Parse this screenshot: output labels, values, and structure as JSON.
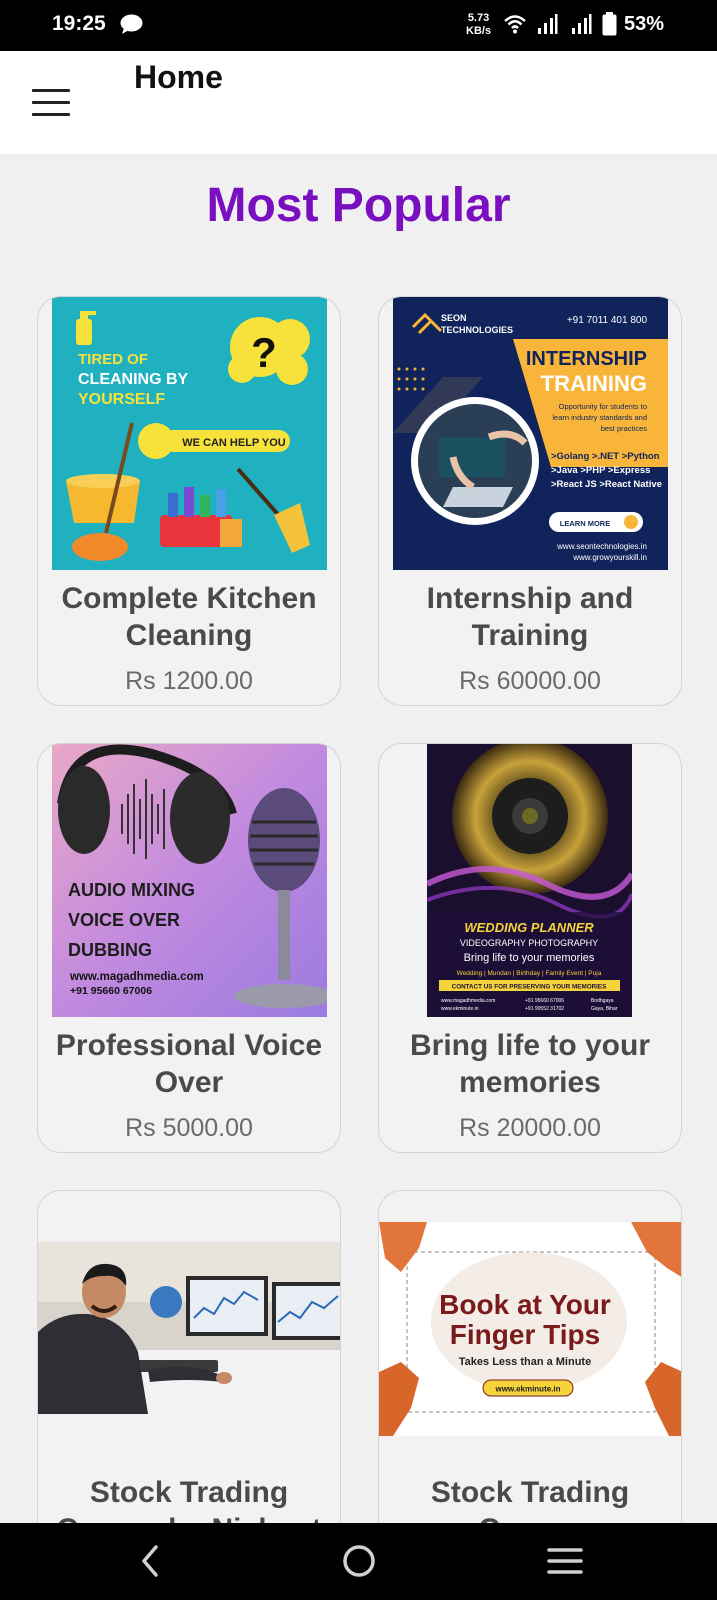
{
  "status_bar": {
    "time": "19:25",
    "speed_value": "5.73",
    "speed_unit": "KB/s",
    "battery": "53%"
  },
  "app_bar": {
    "title": "Home"
  },
  "section": {
    "title": "Most Popular"
  },
  "products": [
    {
      "name": "Complete Kitchen Cleaning",
      "price": "Rs 1200.00",
      "image": {
        "line1": "TIRED OF",
        "line2": "CLEANING BY",
        "line3": "YOURSELF",
        "tagline": "WE CAN HELP YOU"
      }
    },
    {
      "name": "Internship and Training",
      "price": "Rs 60000.00",
      "image": {
        "brand": "SEON",
        "brand2": "TECHNOLOGIES",
        "phone": "+91 7011 401 800",
        "headline1": "INTERNSHIP",
        "headline2": "TRAINING",
        "desc1": "Opportunity for students to",
        "desc2": "learn industry standards and",
        "desc3": "best practices",
        "tech1": ">Golang >.NET >Python",
        "tech2": ">Java >PHP >Express",
        "tech3": ">React JS >React Native",
        "cta": "LEARN MORE",
        "web1": "www.seontechnologies.in",
        "web2": "www.growyourskill.in"
      }
    },
    {
      "name": "Professional Voice Over",
      "price": "Rs 5000.00",
      "image": {
        "line1": "AUDIO MIXING",
        "line2": "VOICE OVER",
        "line3": "DUBBING",
        "web": "www.magadhmedia.com",
        "phone": "+91 95660 67006"
      }
    },
    {
      "name": "Bring life to your memories",
      "price": "Rs 20000.00",
      "image": {
        "headline": "WEDDING PLANNER",
        "sub": "VIDEOGRAPHY  PHOTOGRAPHY",
        "tagline": "Bring life to your memories",
        "events": "Wedding | Mundan | Birthday | Family Event | Puja",
        "cta": "CONTACT US FOR PRESERVING YOUR MEMORIES",
        "web1": "www.magadhmedia.com",
        "web2": "www.ekminute.in",
        "phone1": "+91 95660 67006",
        "phone2": "+91 90552 31702",
        "place1": "Bodhgaya",
        "place2": "Gaya, Bihar"
      }
    },
    {
      "name": "Stock Trading Course by Nishant",
      "price": "",
      "image": {}
    },
    {
      "name": "Stock Trading Course",
      "price": "",
      "image": {
        "headline1": "Book at Your",
        "headline2": "Finger Tips",
        "sub": "Takes Less than a Minute",
        "web": "www.ekminute.in"
      }
    }
  ],
  "colors": {
    "accent": "#7a0fc0",
    "background": "#f0f0f0"
  },
  "icons": {
    "menu": "hamburger-icon",
    "back": "back-icon",
    "home": "home-icon",
    "recents": "recents-icon"
  }
}
